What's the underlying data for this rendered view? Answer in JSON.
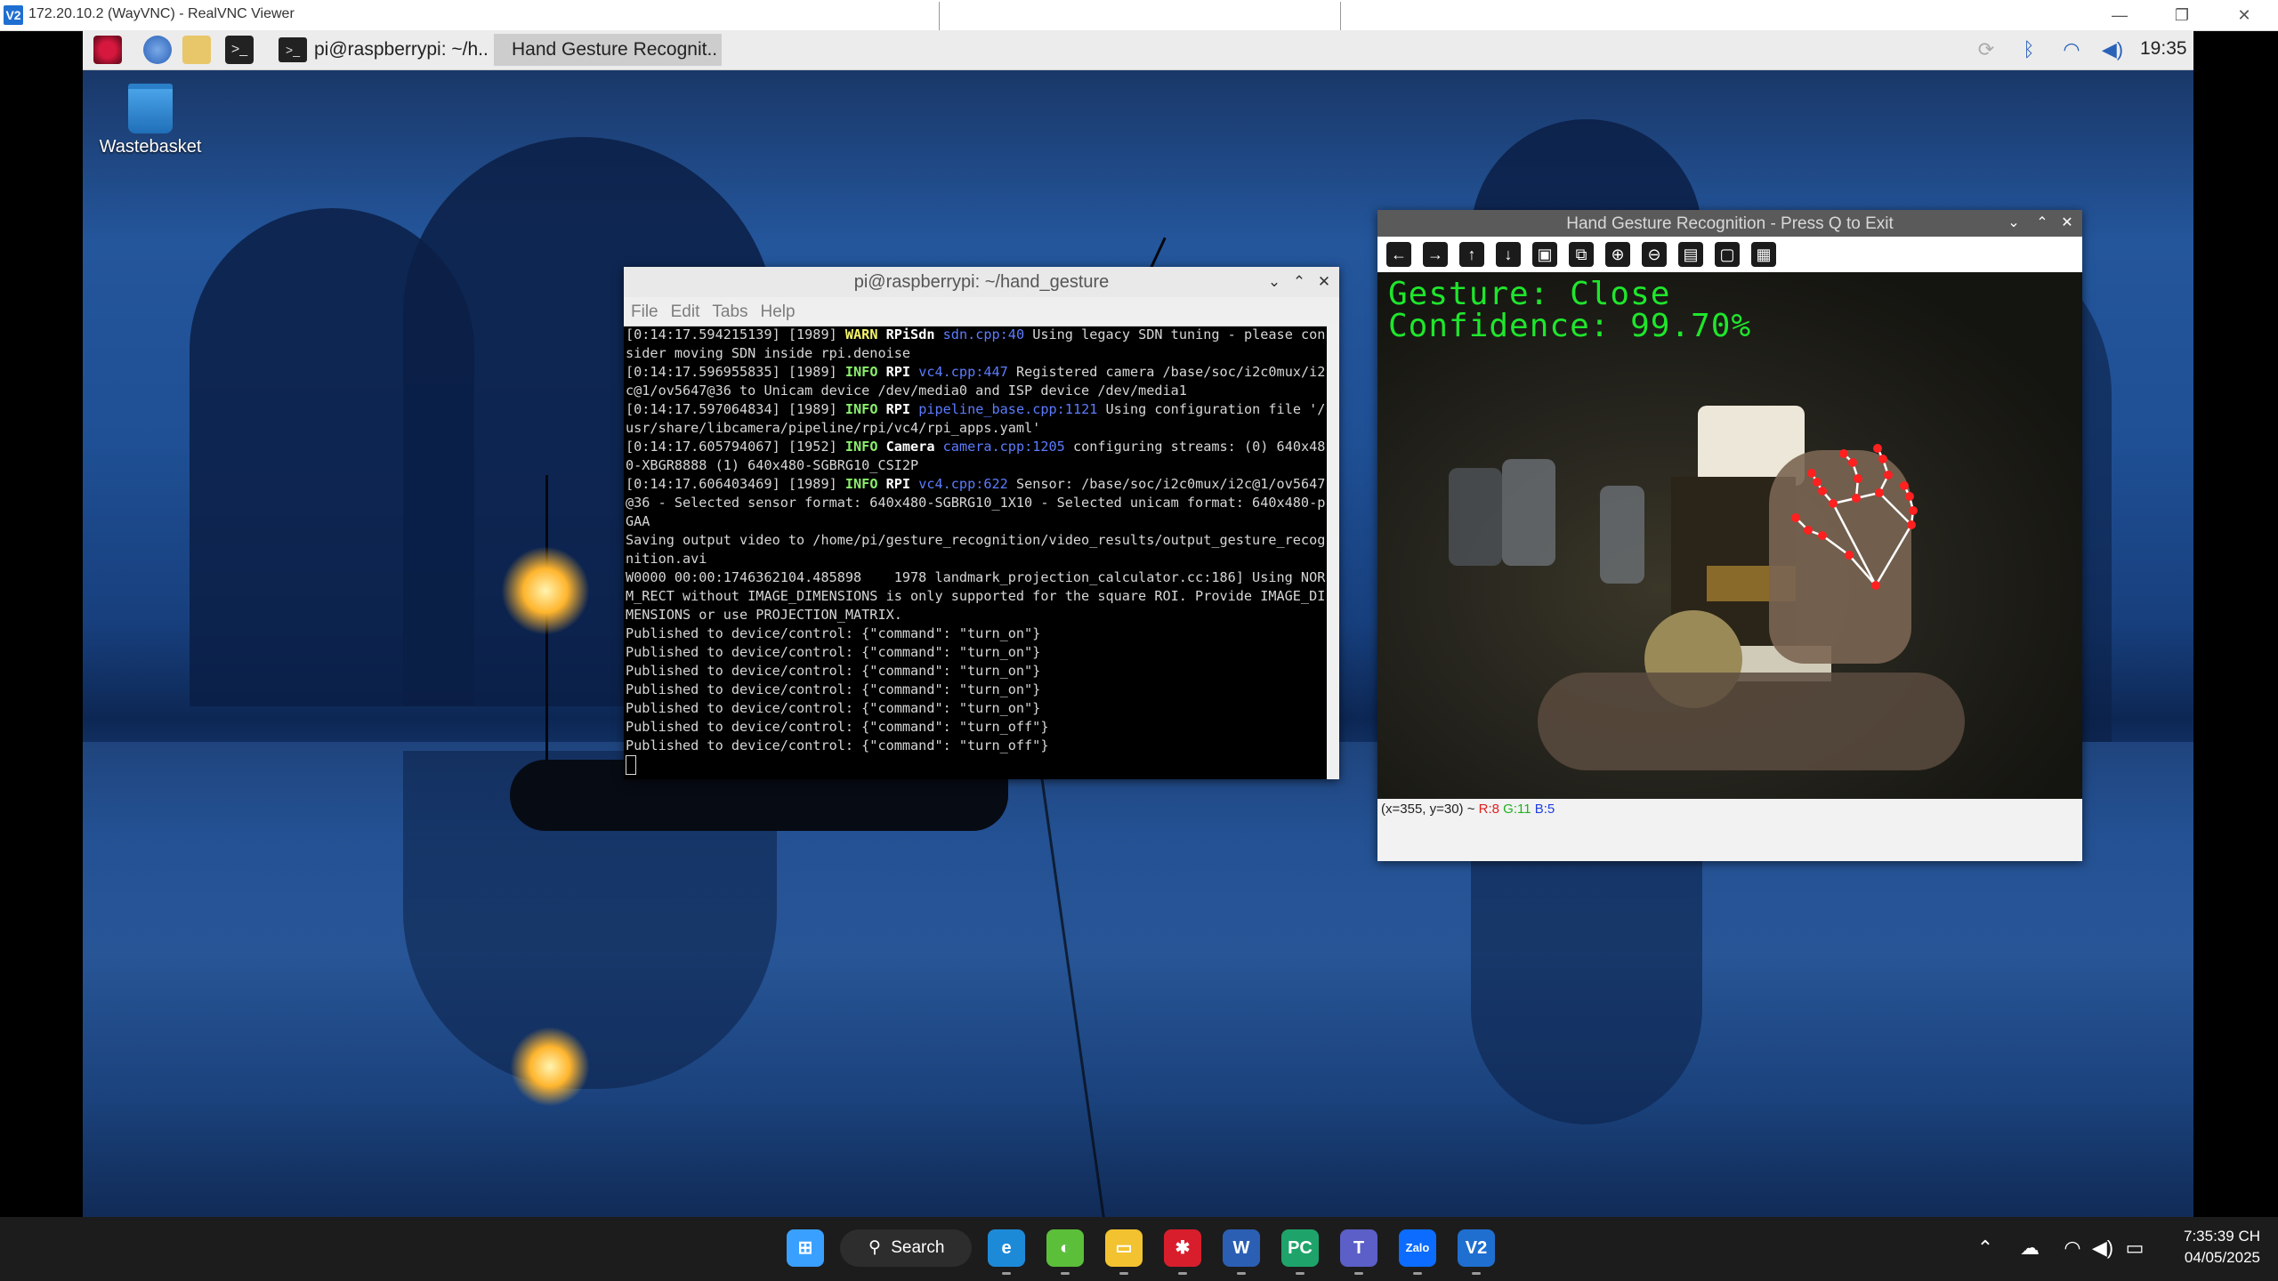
{
  "vnc": {
    "title": "172.20.10.2 (WayVNC) - RealVNC Viewer",
    "logo": "V2",
    "controls": [
      "—",
      "❐",
      "✕"
    ]
  },
  "pi_taskbar": {
    "tasks": [
      {
        "label": "pi@raspberrypi: ~/h..",
        "icon": "terminal-icon"
      },
      {
        "label": "Hand Gesture Recognit..",
        "icon": "",
        "active": true
      }
    ],
    "clock": "19:35"
  },
  "desktop": {
    "icons": [
      {
        "label": "Wastebasket",
        "icon": "trash-icon"
      }
    ]
  },
  "terminal": {
    "title": "pi@raspberrypi: ~/hand_gesture",
    "menu": [
      "File",
      "Edit",
      "Tabs",
      "Help"
    ],
    "lines": [
      {
        "ts": "[0:14:17.594215139] [1989] ",
        "lvl": "WARN",
        "cat": "RPiSdn",
        "src": "sdn.cpp:40",
        "msg": " Using legacy SDN tuning - please consider moving SDN inside rpi.denoise"
      },
      {
        "ts": "[0:14:17.596955835] [1989] ",
        "lvl": "INFO",
        "cat": "RPI",
        "src": "vc4.cpp:447",
        "msg": " Registered camera /base/soc/i2c0mux/i2c@1/ov5647@36 to Unicam device /dev/media0 and ISP device /dev/media1"
      },
      {
        "ts": "[0:14:17.597064834] [1989] ",
        "lvl": "INFO",
        "cat": "RPI",
        "src": "pipeline_base.cpp:1121",
        "msg": " Using configuration file '/usr/share/libcamera/pipeline/rpi/vc4/rpi_apps.yaml'"
      },
      {
        "ts": "[0:14:17.605794067] [1952] ",
        "lvl": "INFO",
        "cat": "Camera",
        "src": "camera.cpp:1205",
        "msg": " configuring streams: (0) 640x480-XBGR8888 (1) 640x480-SGBRG10_CSI2P"
      },
      {
        "ts": "[0:14:17.606403469] [1989] ",
        "lvl": "INFO",
        "cat": "RPI",
        "src": "vc4.cpp:622",
        "msg": " Sensor: /base/soc/i2c0mux/i2c@1/ov5647@36 - Selected sensor format: 640x480-SGBRG10_1X10 - Selected unicam format: 640x480-pGAA"
      }
    ],
    "plain": [
      "Saving output video to /home/pi/gesture_recognition/video_results/output_gesture_recognition.avi",
      "W0000 00:00:1746362104.485898    1978 landmark_projection_calculator.cc:186] Using NORM_RECT without IMAGE_DIMENSIONS is only supported for the square ROI. Provide IMAGE_DIMENSIONS or use PROJECTION_MATRIX.",
      "Published to device/control: {\"command\": \"turn_on\"}",
      "Published to device/control: {\"command\": \"turn_on\"}",
      "Published to device/control: {\"command\": \"turn_on\"}",
      "Published to device/control: {\"command\": \"turn_on\"}",
      "Published to device/control: {\"command\": \"turn_on\"}",
      "Published to device/control: {\"command\": \"turn_off\"}",
      "Published to device/control: {\"command\": \"turn_off\"}"
    ]
  },
  "cv_window": {
    "title": "Hand Gesture Recognition - Press Q to Exit",
    "toolbar_icons": [
      "arrow-left-icon",
      "arrow-right-icon",
      "arrow-up-icon",
      "arrow-down-icon",
      "zoom-fit-icon",
      "zoom-original-icon",
      "zoom-in-icon",
      "zoom-out-icon",
      "save-icon",
      "copy-icon",
      "properties-icon"
    ],
    "toolbar_glyphs": [
      "←",
      "→",
      "↑",
      "↓",
      "▣",
      "⧉",
      "⊕",
      "⊖",
      "▤",
      "▢",
      "▦"
    ],
    "gesture_line": "Gesture: Close",
    "confidence_line": "Confidence: 99.70%",
    "status_prefix": "(x=355, y=30) ~ ",
    "status_r": "R:8",
    "status_g": "G:11",
    "status_b": "B:5"
  },
  "win_taskbar": {
    "search_label": "Search",
    "apps": [
      "start-icon",
      "edge-icon",
      "copilot-icon",
      "file-explorer-icon",
      "app-icon",
      "word-icon",
      "pycharm-icon",
      "teams-icon",
      "zalo-icon",
      "realvnc-icon"
    ],
    "app_glyphs": [
      "⊞",
      "e",
      "◐",
      "▭",
      "✱",
      "W",
      "PC",
      "T",
      "Zalo",
      "V2"
    ],
    "time": "7:35:39 CH",
    "date": "04/05/2025"
  },
  "colors": {
    "accent_vnc": "#1f6fd1",
    "overlay_green": "#1fe62c",
    "landmark_red": "#ff2020",
    "term_warn": "#f4f46a",
    "term_info": "#8af06b",
    "term_src": "#5c7cff"
  }
}
